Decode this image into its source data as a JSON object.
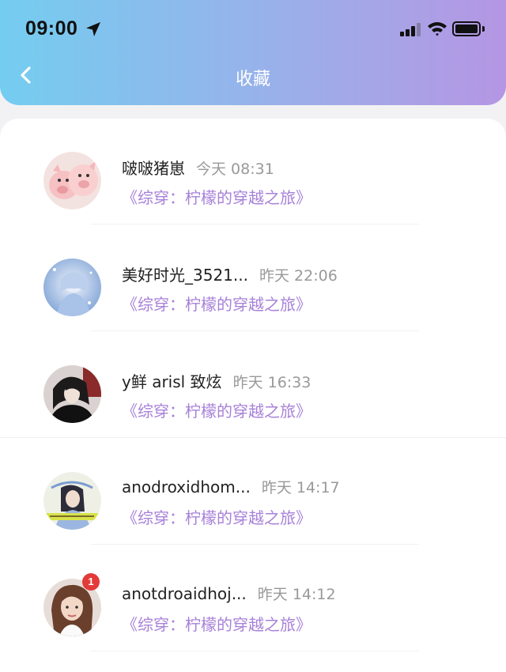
{
  "status_bar": {
    "time": "09:00"
  },
  "header": {
    "title": "收藏"
  },
  "colors": {
    "accent": "#a781d8",
    "header_left": "#74cdf0",
    "header_right": "#b596e4",
    "badge": "#e33a3a"
  },
  "list": [
    {
      "name": "啵啵猪崽",
      "time": "今天 08:31",
      "book": "《综穿：柠檬的穿越之旅》",
      "avatar": "pig-plush-avatar"
    },
    {
      "name": "美好时光_3521...",
      "time": "昨天 22:06",
      "book": "《综穿：柠檬的穿越之旅》",
      "avatar": "anime-girl-avatar"
    },
    {
      "name": "y鲜 arisl 致炫",
      "time": "昨天 16:33",
      "book": "《综穿：柠檬的穿越之旅》",
      "avatar": "dark-character-avatar"
    },
    {
      "name": "anodroxidhom...",
      "time": "昨天 14:17",
      "book": "《综穿：柠檬的穿越之旅》",
      "avatar": "girl-photo-avatar"
    },
    {
      "name": "anotdroaidhoj...",
      "time": "昨天 14:12",
      "book": "《综穿：柠檬的穿越之旅》",
      "avatar": "woman-photo-avatar",
      "badge": "1"
    }
  ]
}
